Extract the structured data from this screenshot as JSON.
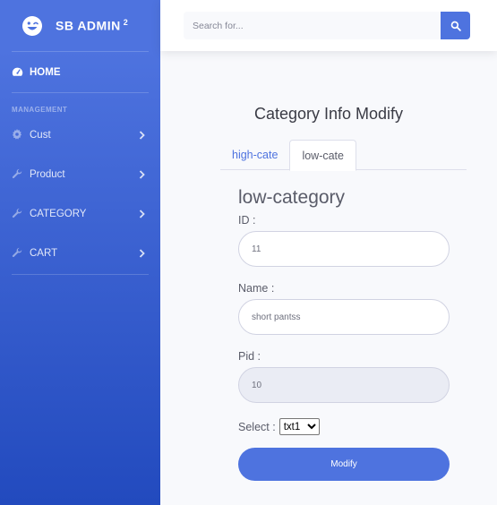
{
  "sidebar": {
    "brand": "SB ADMIN",
    "brand_sup": "2",
    "home": "HOME",
    "heading": "MANAGEMENT",
    "items": [
      {
        "label": "Cust"
      },
      {
        "label": "Product"
      },
      {
        "label": "CATEGORY"
      },
      {
        "label": "CART"
      }
    ]
  },
  "topbar": {
    "search_placeholder": "Search for..."
  },
  "main": {
    "title": "Category Info Modify",
    "tabs": [
      {
        "label": "high-cate",
        "active": false
      },
      {
        "label": "low-cate",
        "active": true
      }
    ],
    "form": {
      "title": "low-category",
      "id_label": "ID :",
      "id_value": "11",
      "name_label": "Name :",
      "name_value": "short pantss",
      "pid_label": "Pid :",
      "pid_value": "10",
      "select_label": "Select :",
      "select_value": "txt1",
      "submit_label": "Modify"
    }
  },
  "colors": {
    "primary": "#4e73df",
    "sidebar_bottom": "#224abe"
  }
}
